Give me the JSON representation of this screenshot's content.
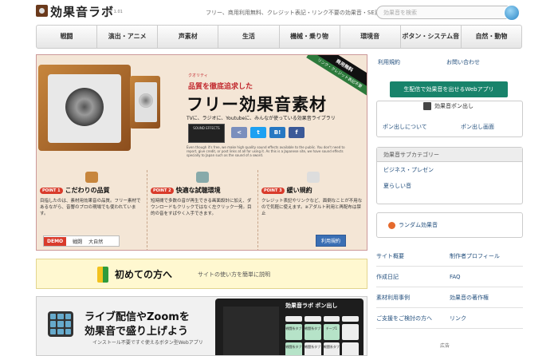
{
  "header": {
    "logo": "効果音ラボ",
    "version": "ver 1.01",
    "tagline": "フリー、商用利用無料、クレジット表記・リンク不要の効果音・SE素材をダウンロード",
    "search_placeholder": "効果音を検索"
  },
  "nav": [
    "戦闘",
    "演出・アニメ",
    "声素材",
    "生活",
    "機械・乗り物",
    "環境音",
    "ボタン・システム音",
    "自然・動物"
  ],
  "hero": {
    "quality_prefix": "クオリティ",
    "quality": "品質を徹底追求した",
    "title": "フリー効果音素材",
    "sub": "TVに、ラジオに、Youtubeに、みんなが使っている効果音ライブラリ",
    "badge_top": "商用無料",
    "badge_bottom": "リンク・クレジット表記不要",
    "counter": "SOUND EFFECTS",
    "english": "Even though it's free, we make high quality sound effects available to the public. You don't need to report, give credit, or post links at all for using it. As this is a Japanese site, we have sound effects specially to Japan such as the sound of a sword.",
    "points": [
      {
        "tag": "POINT 1",
        "title": "こだわりの品質",
        "body": "目指したのは、素材用効果音の品質。フリー素材であるながら、音響のプロの現場でも使われています。"
      },
      {
        "tag": "POINT 2",
        "title": "快適な試聴環境",
        "body": "短時間で多数の音が再生できる画面設計に加え、ダウンロードもクリックではなく左クリック一発。目的の音をすばやく入手できます。"
      },
      {
        "tag": "POINT 3",
        "title": "緩い規約",
        "body": "クレジット表記やリンクなど、面倒なことが不用なので気軽に使えます。※アダルト利用と再配布は禁止"
      }
    ],
    "demo_label": "DEMO",
    "demo_items": [
      "戦闘",
      "大自然"
    ],
    "terms_button": "利用規約"
  },
  "first": {
    "title": "初めての方へ",
    "desc": "サイトの使い方を簡単に説明"
  },
  "live": {
    "line1": "ライブ配信やZoomを",
    "line2": "効果音で盛り上げよう",
    "sub": "インストール不要ですぐ使えるボタン型Webアプリ",
    "device_logo": "効果音ラボ ポン出し",
    "pads": [
      "",
      "",
      "",
      "",
      "戦闘系タブ",
      "戦闘系タブ",
      "チーブ1",
      "",
      "戦闘系タブ",
      "戦闘系タブ",
      "戦闘系タブ",
      ""
    ]
  },
  "sidebar": {
    "terms": "利用規約",
    "contact": "お問い合わせ",
    "webapp_button": "生配信で効果音を出せるWebアプリ",
    "ponpop_title": "効果音ポン出し",
    "ponpop_about": "ポン出しについて",
    "ponpop_screen": "ポン出し画面",
    "category_title": "効果音サブカテゴリー",
    "categories": [
      "ビジネス・プレゼン",
      "夏らしい音"
    ],
    "random": "ランダム効果音",
    "links": [
      [
        "サイト概要",
        "制作者プロフィール"
      ],
      [
        "作成日記",
        "FAQ"
      ],
      [
        "素材利用事例",
        "効果音の著作権"
      ],
      [
        "ご支援をご検討の方へ",
        "リンク"
      ]
    ],
    "ad": "広告"
  }
}
